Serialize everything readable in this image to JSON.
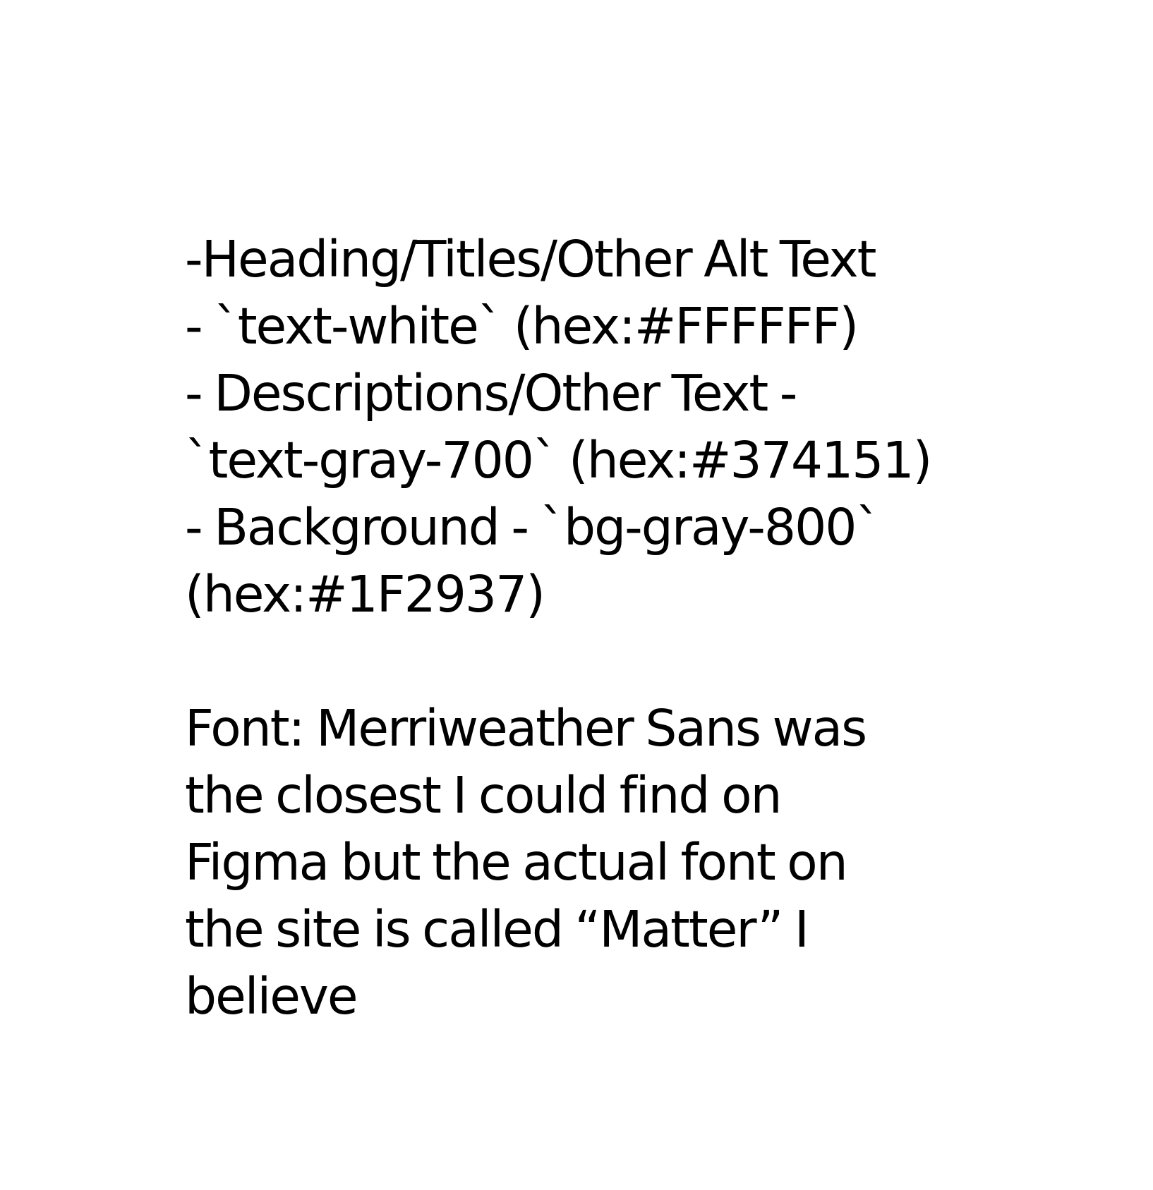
{
  "note": {
    "color_lines": [
      "-Heading/Titles/Other Alt Text",
      "- `text-white` (hex:#FFFFFF)",
      "- Descriptions/Other Text -",
      "`text-gray-700` (hex:#374151)",
      "- Background - `bg-gray-800`",
      "(hex:#1F2937)"
    ],
    "font_lines": [
      "Font: Merriweather Sans was",
      "the closest I could find on",
      "Figma but the actual font on",
      "the site is called “Matter” I",
      "believe"
    ]
  },
  "colors": {
    "text": "#000000",
    "background": "#FFFFFF"
  }
}
